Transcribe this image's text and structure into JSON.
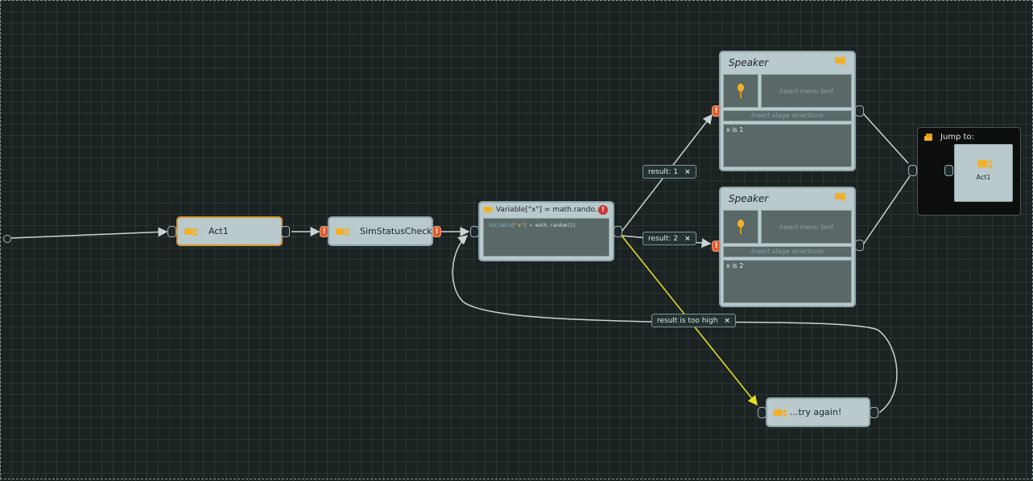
{
  "nodes": {
    "act1": {
      "label": "Act1"
    },
    "sim_status": {
      "label": "SimStatusCheck"
    },
    "variable": {
      "header": "Variable[\"x\"] = math.rando...",
      "code_kw": "Variable",
      "code_str": "[\"x\"]",
      "code_rest": " = math.random(2)"
    },
    "speaker1": {
      "title": "Speaker",
      "menu_placeholder": "Insert menu text",
      "stage_placeholder": "Insert stage directions",
      "text": "x is 1"
    },
    "speaker2": {
      "title": "Speaker",
      "menu_placeholder": "Insert menu text",
      "stage_placeholder": "Insert stage directions",
      "text": "x is 2"
    },
    "try_again": {
      "label": "...try again!"
    },
    "jump": {
      "title": "Jump to:",
      "target": "Act1"
    }
  },
  "conditions": {
    "result1": {
      "label": "result: 1",
      "close": "×"
    },
    "result2": {
      "label": "result: 2",
      "close": "×"
    },
    "too_high": {
      "label": "result is too high",
      "close": "×"
    }
  },
  "colors": {
    "node_fill": "#b9c9cc",
    "selected_border": "#d9962f",
    "warning_pin": "#e55a2b",
    "highlight_wire": "#e6e21a",
    "wire": "#c8d4d4"
  }
}
